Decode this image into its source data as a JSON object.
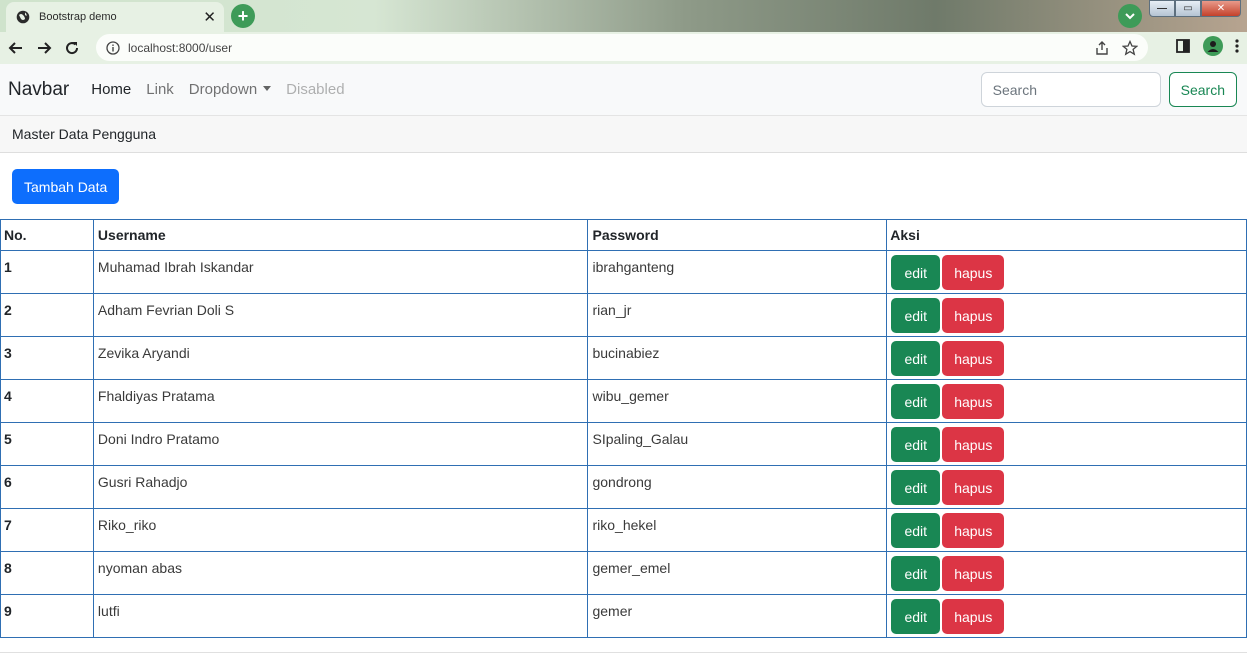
{
  "browser": {
    "tab_title": "Bootstrap demo",
    "tab_close": "✕",
    "new_tab": "+",
    "url": "localhost:8000/user",
    "win_min": "—",
    "win_max": "▭",
    "win_close": "✕"
  },
  "navbar": {
    "brand": "Navbar",
    "links": {
      "home": "Home",
      "link": "Link",
      "dropdown": "Dropdown",
      "disabled": "Disabled"
    },
    "search_placeholder": "Search",
    "search_button": "Search"
  },
  "page": {
    "header": "Master Data Pengguna",
    "add_button": "Tambah Data"
  },
  "table": {
    "headers": {
      "no": "No.",
      "username": "Username",
      "password": "Password",
      "aksi": "Aksi"
    },
    "edit_label": "edit",
    "delete_label": "hapus",
    "rows": [
      {
        "no": "1",
        "username": "Muhamad Ibrah Iskandar",
        "password": "ibrahganteng"
      },
      {
        "no": "2",
        "username": "Adham Fevrian Doli S",
        "password": "rian_jr"
      },
      {
        "no": "3",
        "username": "Zevika Aryandi",
        "password": "bucinabiez"
      },
      {
        "no": "4",
        "username": "Fhaldiyas Pratama",
        "password": "wibu_gemer"
      },
      {
        "no": "5",
        "username": "Doni Indro Pratamo",
        "password": "SIpaling_Galau"
      },
      {
        "no": "6",
        "username": "Gusri Rahadjo",
        "password": "gondrong"
      },
      {
        "no": "7",
        "username": "Riko_riko",
        "password": "riko_hekel"
      },
      {
        "no": "8",
        "username": "nyoman abas",
        "password": "gemer_emel"
      },
      {
        "no": "9",
        "username": "lutfi",
        "password": "gemer"
      }
    ]
  },
  "colors": {
    "primary": "#0d6efd",
    "success": "#198754",
    "danger": "#dc3545",
    "table_border": "#2f6fb3",
    "chrome_green": "#3e9b58"
  }
}
